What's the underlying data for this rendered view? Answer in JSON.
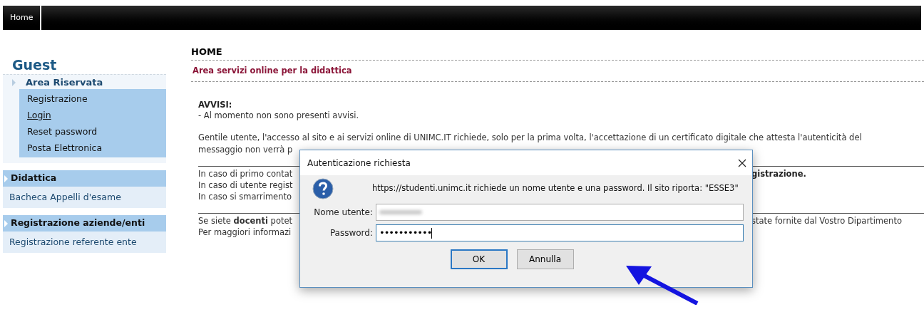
{
  "topbar": {
    "tabs": [
      {
        "label": "Home",
        "selected": true
      }
    ]
  },
  "sidebar": {
    "title": "Guest",
    "sections": [
      {
        "label": "Area Riservata",
        "kind": "light",
        "items": [
          {
            "label": "Registrazione",
            "link": false
          },
          {
            "label": "Login",
            "link": true
          },
          {
            "label": "Reset password",
            "link": false
          },
          {
            "label": "Posta Elettronica",
            "link": false
          }
        ]
      },
      {
        "label": "Didattica",
        "kind": "header",
        "items": [
          {
            "label": "Bacheca Appelli d'esame",
            "link": false
          }
        ]
      },
      {
        "label": "Registrazione aziende/enti",
        "kind": "header",
        "items": [
          {
            "label": "Registrazione referente ente",
            "link": false
          }
        ]
      }
    ]
  },
  "content": {
    "heading": "HOME",
    "subheading": "Area servizi online per la didattica",
    "notice_title": "AVVISI:",
    "notice_text": "- Al momento non sono presenti avvisi.",
    "intro_line": "Gentile utente, l'accesso al sito e ai servizi online di UNIMC.IT richiede, solo per la prima volta, l'accettazione di un certificato digitale che attesta l'autenticità del",
    "blocks": [
      [
        {
          "left": "messaggio non verrà p"
        }
      ],
      [
        {
          "left": "In caso di primo contat",
          "right": "gistrazione."
        },
        {
          "left": "In caso di utente regist"
        },
        {
          "left": "In caso si smarrimento"
        }
      ],
      [
        {
          "left": "Se siete **docenti** potet",
          "right": "state fornite dal Vostro Dipartimento"
        },
        {
          "left": "Per maggiori informazi"
        }
      ]
    ]
  },
  "dialog": {
    "title": "Autenticazione richiesta",
    "message": "https://studenti.unimc.it richiede un nome utente e una password. Il sito riporta: \"ESSE3\"",
    "fields": [
      {
        "label": "Nome utente:",
        "kind": "blurred",
        "focused": false
      },
      {
        "label": "Password:",
        "kind": "password",
        "value": "•••••••••••",
        "focused": true
      }
    ],
    "buttons": [
      {
        "label": "OK",
        "default": true
      },
      {
        "label": "Annulla",
        "default": false
      }
    ]
  }
}
